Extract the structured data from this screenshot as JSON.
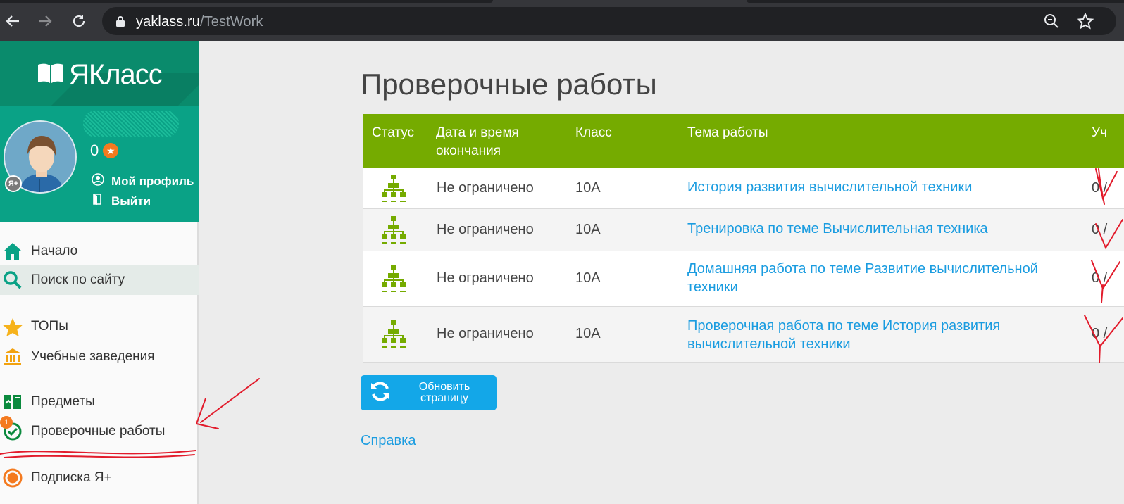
{
  "browser": {
    "url_host": "yaklass.ru",
    "url_path": "/TestWork"
  },
  "sidebar": {
    "logo_text": "ЯКласс",
    "profile": {
      "score": "0",
      "star": "★",
      "avatar_badge": "Я+",
      "my_profile": "Мой профиль",
      "logout": "Выйти"
    },
    "menu": [
      {
        "label": "Начало",
        "icon": "home-icon"
      },
      {
        "label": "Поиск по сайту",
        "icon": "search-icon"
      },
      {
        "label": "ТОПы",
        "icon": "star-icon"
      },
      {
        "label": "Учебные заведения",
        "icon": "institution-icon"
      },
      {
        "label": "Предметы",
        "icon": "books-icon"
      },
      {
        "label": "Проверочные работы",
        "icon": "check-icon",
        "badge": "1"
      },
      {
        "label": "Подписка Я+",
        "icon": "subscription-icon"
      }
    ]
  },
  "main": {
    "title": "Проверочные работы",
    "table": {
      "headers": {
        "status": "Статус",
        "deadline": "Дата и время окончания",
        "class": "Класс",
        "topic": "Тема работы",
        "score": "Уч"
      },
      "rows": [
        {
          "deadline": "Не ограничено",
          "class": "10А",
          "topic": "История развития вычислительной техники",
          "score": "0 /"
        },
        {
          "deadline": "Не ограничено",
          "class": "10А",
          "topic": "Тренировка по теме Вычислительная техника",
          "score": "0 /"
        },
        {
          "deadline": "Не ограничено",
          "class": "10А",
          "topic": "Домашняя работа по теме Развитие вычислительной техники",
          "score": "0 /"
        },
        {
          "deadline": "Не ограничено",
          "class": "10А",
          "topic": "Проверочная работа по теме История развития вычислительной техники",
          "score": "0 /"
        }
      ]
    },
    "refresh_button": "Обновить страницу",
    "help_link": "Справка"
  },
  "colors": {
    "brand_green": "#0a8b6c",
    "table_header": "#75ab00",
    "link_blue": "#1a9ce0",
    "button_blue": "#13a7e8",
    "annotation_red": "#e21b2b"
  }
}
